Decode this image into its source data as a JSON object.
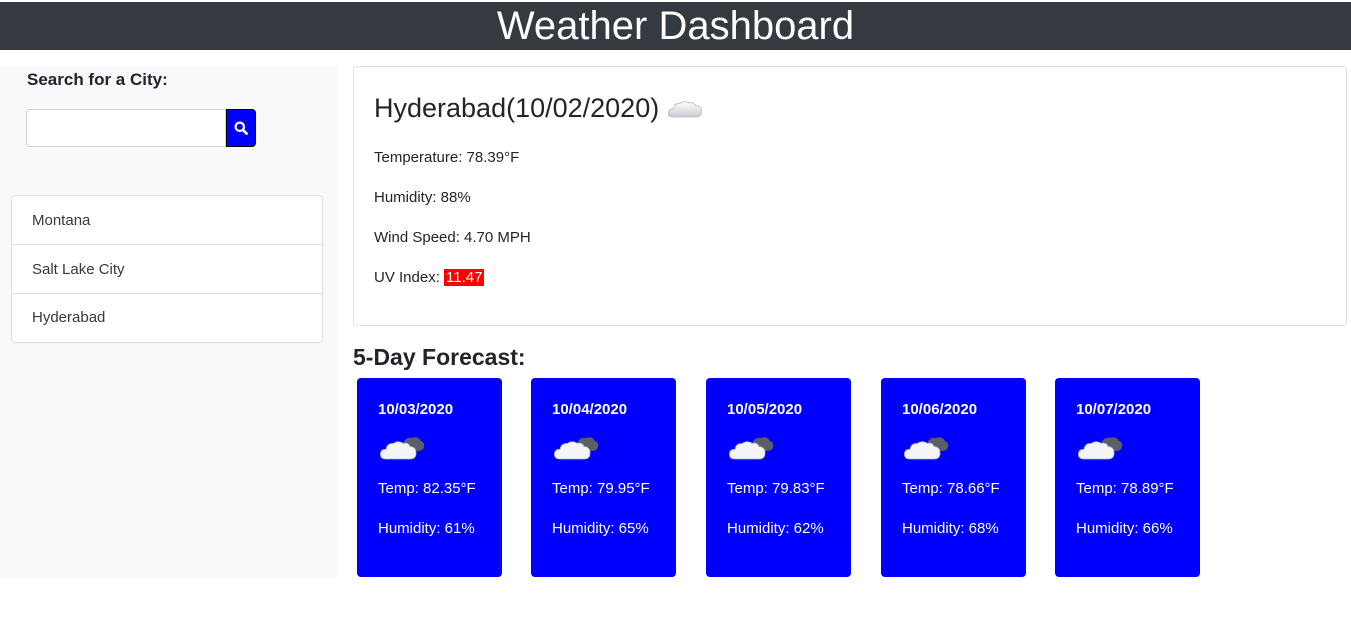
{
  "header": {
    "title": "Weather Dashboard"
  },
  "search": {
    "label": "Search for a City:",
    "value": "",
    "placeholder": "",
    "button_icon": "search-icon"
  },
  "history": [
    {
      "label": "Montana"
    },
    {
      "label": "Salt Lake City"
    },
    {
      "label": "Hyderabad"
    }
  ],
  "current": {
    "title": "Hyderabad(10/02/2020)",
    "icon": "cloud-icon",
    "temperature": "Temperature: 78.39°F",
    "humidity": "Humidity: 88%",
    "wind": "Wind Speed: 4.70 MPH",
    "uv_label": "UV Index: ",
    "uv_value": "11.47"
  },
  "forecast": {
    "heading": "5-Day Forecast:",
    "days": [
      {
        "date": "10/03/2020",
        "icon": "cloudy-icon",
        "temp": "Temp: 82.35°F",
        "humidity": "Humidity: 61%"
      },
      {
        "date": "10/04/2020",
        "icon": "cloudy-icon",
        "temp": "Temp: 79.95°F",
        "humidity": "Humidity: 65%"
      },
      {
        "date": "10/05/2020",
        "icon": "cloudy-icon",
        "temp": "Temp: 79.83°F",
        "humidity": "Humidity: 62%"
      },
      {
        "date": "10/06/2020",
        "icon": "cloudy-icon",
        "temp": "Temp: 78.66°F",
        "humidity": "Humidity: 68%"
      },
      {
        "date": "10/07/2020",
        "icon": "cloudy-icon",
        "temp": "Temp: 78.89°F",
        "humidity": "Humidity: 66%"
      }
    ]
  },
  "colors": {
    "header_bg": "#343a40",
    "accent": "#0000ff",
    "uv_high": "#ff0000",
    "sidebar_bg": "#f8f9fa"
  }
}
